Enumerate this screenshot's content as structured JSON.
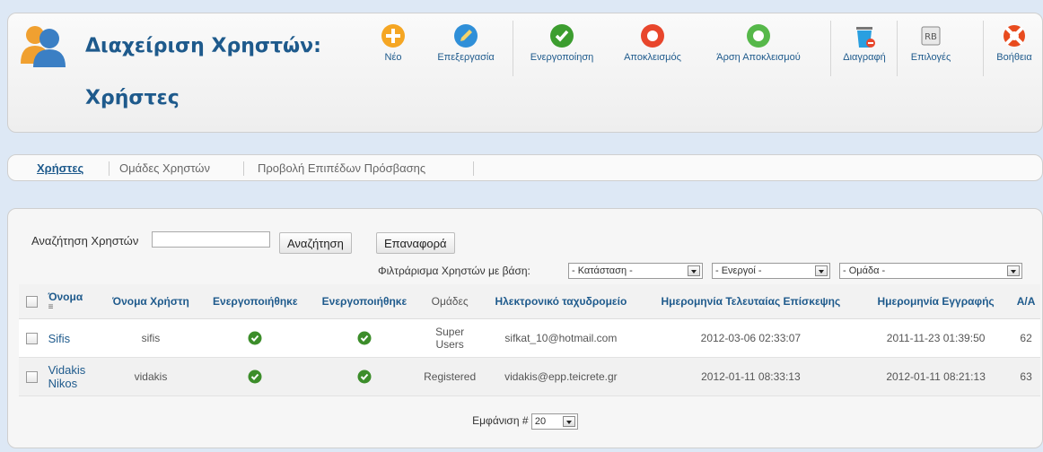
{
  "header": {
    "title": "Διαχείριση Χρηστών:",
    "subtitle": "Χρήστες"
  },
  "toolbar": {
    "new": "Νέο",
    "edit": "Επεξεργασία",
    "activate": "Ενεργοποίηση",
    "block": "Αποκλεισμός",
    "unblock": "Άρση Αποκλεισμού",
    "delete": "Διαγραφή",
    "options": "Επιλογές",
    "help": "Βοήθεια",
    "colors": {
      "new": "#f5a623",
      "edit": "#2f8fd8",
      "activate": "#3c9d2f",
      "block": "#e8462c",
      "unblock": "#56b84a",
      "delete": "#2a9fe0",
      "help": "#e84b1e"
    }
  },
  "tabs": [
    {
      "label": "Χρήστες",
      "active": true
    },
    {
      "label": "Ομάδες Χρηστών",
      "active": false
    },
    {
      "label": "Προβολή Επιπέδων Πρόσβασης",
      "active": false
    }
  ],
  "search": {
    "label": "Αναζήτηση Χρηστών",
    "value": "",
    "search_button": "Αναζήτηση",
    "reset_button": "Επαναφορά"
  },
  "filters": {
    "label": "Φιλτράρισμα Χρηστών με βάση:",
    "state": "- Κατάσταση -",
    "active": "- Ενεργοί -",
    "group": "- Ομάδα -"
  },
  "table": {
    "headers": {
      "name": "Όνομα",
      "username": "Όνομα Χρήστη",
      "enabled": "Ενεργοποιήθηκε",
      "activated": "Ενεργοποιήθηκε",
      "groups": "Ομάδες",
      "email": "Ηλεκτρονικό ταχυδρομείο",
      "last_visit": "Ημερομηνία Τελευταίας Επίσκεψης",
      "registered": "Ημερομηνία Εγγραφής",
      "id": "Α/Α"
    },
    "rows": [
      {
        "name": "Sifis",
        "username": "sifis",
        "groups": "Super Users",
        "email": "sifkat_10@hotmail.com",
        "last_visit": "2012-03-06 02:33:07",
        "registered": "2011-11-23 01:39:50",
        "id": "62"
      },
      {
        "name": "Vidakis Nikos",
        "username": "vidakis",
        "groups": "Registered",
        "email": "vidakis@epp.teicrete.gr",
        "last_visit": "2012-01-11 08:33:13",
        "registered": "2012-01-11 08:21:13",
        "id": "63"
      }
    ]
  },
  "pager": {
    "label": "Εμφάνιση #",
    "value": "20"
  }
}
